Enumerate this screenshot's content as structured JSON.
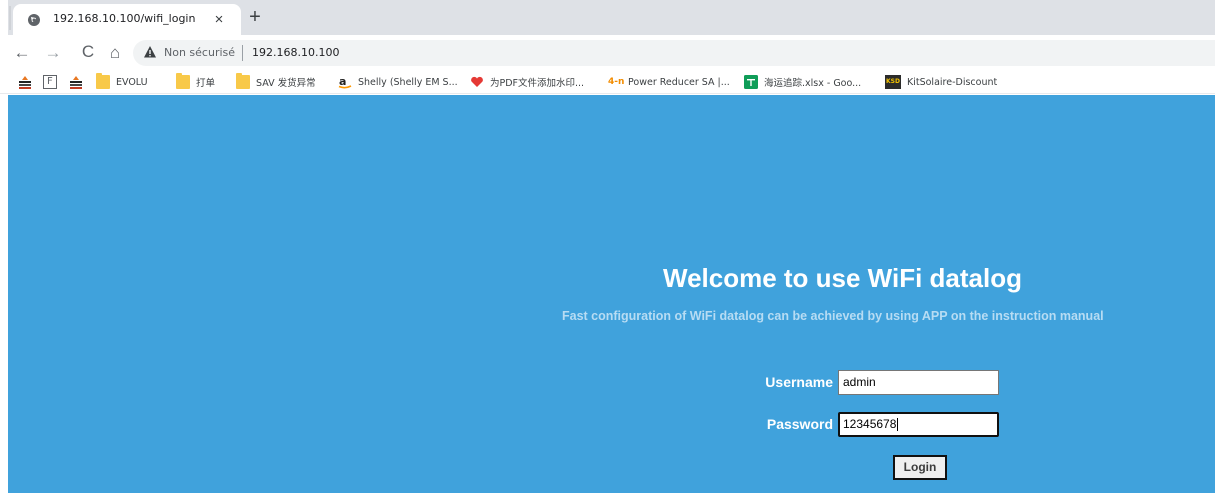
{
  "browser": {
    "tab": {
      "title": "192.168.10.100/wifi_login",
      "close_glyph": "×"
    },
    "new_tab_glyph": "+",
    "nav": {
      "back_glyph": "←",
      "forward_glyph": "→",
      "reload_glyph": "C",
      "home_glyph": "⌂"
    },
    "omnibox": {
      "security_text": "Non sécurisé",
      "url": "192.168.10.100"
    },
    "bookmarks": [
      {
        "label": "",
        "icon": "colored-bars-icon"
      },
      {
        "label": "",
        "icon": "f-letter-icon"
      },
      {
        "label": "",
        "icon": "colored-bars-icon"
      },
      {
        "label": "EVOLU",
        "icon": "folder-icon"
      },
      {
        "label": "打单",
        "icon": "folder-icon"
      },
      {
        "label": "SAV 发货异常",
        "icon": "folder-icon"
      },
      {
        "label": "Shelly (Shelly EM S...",
        "icon": "amazon-icon"
      },
      {
        "label": "为PDF文件添加水印...",
        "icon": "heart-icon"
      },
      {
        "label": "Power Reducer SA |...",
        "icon": "4n-icon"
      },
      {
        "label": "海运追踪.xlsx - Goo...",
        "icon": "sheets-icon"
      },
      {
        "label": "KitSolaire-Discount",
        "icon": "ksd-icon"
      }
    ],
    "four_n_text": "4-n",
    "ksd_text": "KSD",
    "f_text": "F"
  },
  "page": {
    "heading": "Welcome to use WiFi datalog",
    "subtitle": "Fast configuration of WiFi datalog can be achieved by using APP on the instruction manual",
    "username_label": "Username",
    "username_value": "admin",
    "password_label": "Password",
    "password_value": "12345678",
    "login_label": "Login"
  },
  "colors": {
    "page_background": "#40a2dc",
    "subtitle": "#b7dcf3",
    "tabstrip": "#dee1e6",
    "folder": "#f8c949"
  }
}
